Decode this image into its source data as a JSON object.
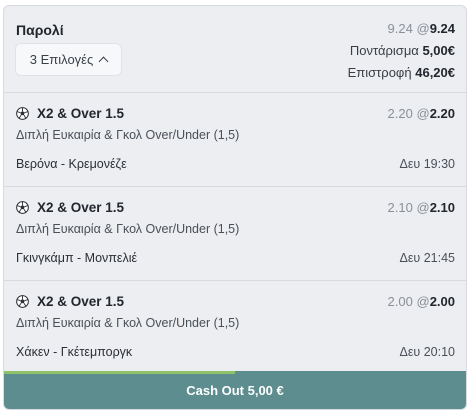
{
  "summary": {
    "title": "Παρολί",
    "selections_button": "3 Επιλογές",
    "odds_from": "9.24",
    "odds_at": "@",
    "odds_to": "9.24",
    "stake_label": "Ποντάρισμα",
    "stake_value": "5,00€",
    "return_label": "Επιστροφή",
    "return_value": "46,20€"
  },
  "selections": [
    {
      "name": "X2 & Over 1.5",
      "market": "Διπλή Ευκαιρία & Γκολ Over/Under (1,5)",
      "match": "Βερόνα - Κρεμονέζε",
      "odds_from": "2.20",
      "odds_at": "@",
      "odds_to": "2.20",
      "time": "Δευ 19:30"
    },
    {
      "name": "X2 & Over 1.5",
      "market": "Διπλή Ευκαιρία & Γκολ Over/Under (1,5)",
      "match": "Γκινγκάμπ - Μονπελιέ",
      "odds_from": "2.10",
      "odds_at": "@",
      "odds_to": "2.10",
      "time": "Δευ 21:45"
    },
    {
      "name": "X2 & Over 1.5",
      "market": "Διπλή Ευκαιρία & Γκολ Over/Under (1,5)",
      "match": "Χάκεν - Γκέτεμποργκ",
      "odds_from": "2.00",
      "odds_at": "@",
      "odds_to": "2.00",
      "time": "Δευ 20:10"
    }
  ],
  "cashout": {
    "label": "Cash Out 5,00 €",
    "progress": 0.5
  },
  "colors": {
    "cashout_bg": "#5e8d8f",
    "progress": "#8fc36a"
  },
  "icons": {
    "selection": "soccer-ball-icon",
    "selections_button": "chevron-up-icon"
  }
}
